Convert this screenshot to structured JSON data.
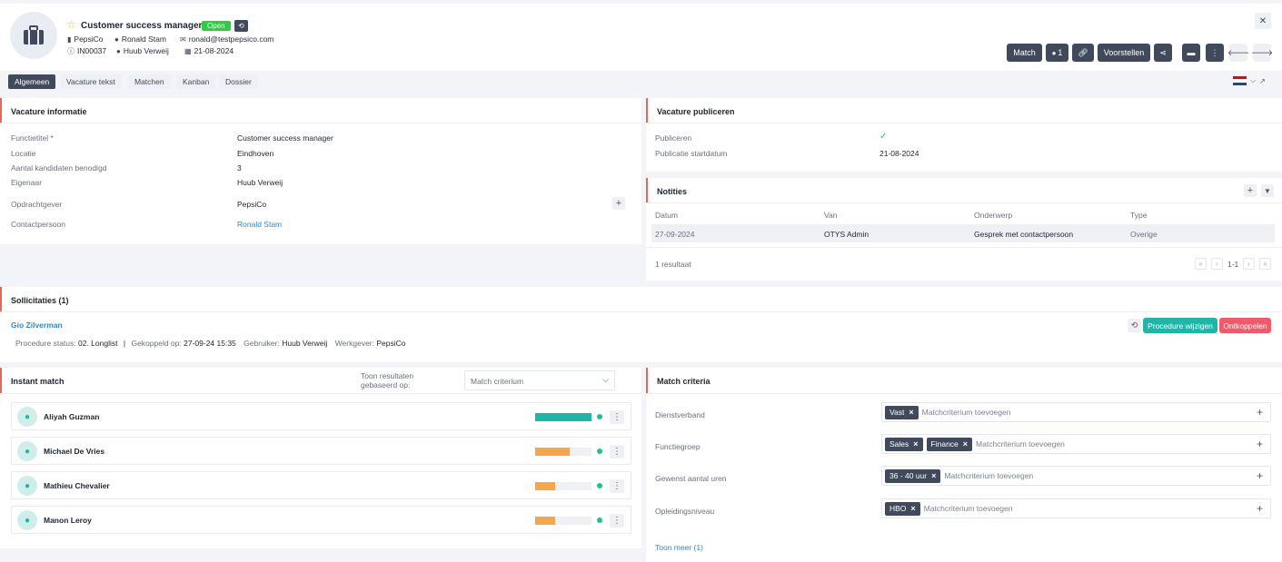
{
  "header": {
    "title": "Customer success manager",
    "status": "Open",
    "company": "PepsiCo",
    "contact": "Ronald Stam",
    "email": "ronald@testpepsico.com",
    "id": "IN00037",
    "owner": "Huub Verweij",
    "date": "21-08-2024",
    "buttons": {
      "match": "Match",
      "count": "1",
      "propose": "Voorstellen"
    }
  },
  "tabs": [
    "Algemeen",
    "Vacature tekst",
    "Matchen",
    "Kanban",
    "Dossier"
  ],
  "vacancy_info": {
    "title": "Vacature informatie",
    "rows": [
      {
        "label": "Functietitel *",
        "value": "Customer success manager"
      },
      {
        "label": "Locatie",
        "value": "Eindhoven"
      },
      {
        "label": "Aantal kandidaten benodigd",
        "value": "3"
      },
      {
        "label": "Eigenaar",
        "value": "Huub Verweij"
      },
      {
        "label": "Opdrachtgever",
        "value": "PepsiCo"
      },
      {
        "label": "Contactpersoon",
        "value": "Ronald Stam"
      }
    ]
  },
  "publish": {
    "title": "Vacature publiceren",
    "publish_label": "Publiceren",
    "publish_value": "✓",
    "start_label": "Publicatie startdatum",
    "start_value": "21-08-2024"
  },
  "notes": {
    "title": "Notities",
    "columns": [
      "Datum",
      "Van",
      "Onderwerp",
      "Type"
    ],
    "rows": [
      [
        "27-09-2024",
        "OTYS Admin",
        "Gesprek met contactpersoon",
        "Overige"
      ]
    ],
    "result": "1 resultaat",
    "page": "1-1"
  },
  "applications": {
    "title": "Sollicitaties (1)",
    "name": "Gio Zilverman",
    "status_label": "Procedure status:",
    "status_value": "02. Longlist",
    "linked_label": "Gekoppeld op:",
    "linked_value": "27-09-24 15:35",
    "user_label": "Gebruiker:",
    "user_value": "Huub Verweij",
    "employer_label": "Werkgever:",
    "employer_value": "PepsiCo",
    "change_button": "Procedure wijzigen",
    "unlink_button": "Ontkoppelen"
  },
  "instant_match": {
    "title": "Instant match",
    "based_label_1": "Toon resultaten",
    "based_label_2": "gebaseerd op:",
    "select_value": "Match criterium",
    "candidates": [
      {
        "name": "Aliyah Guzman",
        "score": 1.0,
        "color": "#20b5a6"
      },
      {
        "name": "Michael De Vries",
        "score": 0.62,
        "color": "#f5a54a"
      },
      {
        "name": "Mathieu Chevalier",
        "score": 0.36,
        "color": "#f5a54a"
      },
      {
        "name": "Manon Leroy",
        "score": 0.36,
        "color": "#f5a54a"
      }
    ]
  },
  "match_criteria": {
    "title": "Match criteria",
    "placeholder": "Matchcriterium toevoegen",
    "rows": [
      {
        "label": "Dienstverband",
        "chips": [
          "Vast"
        ]
      },
      {
        "label": "Functiegroep",
        "chips": [
          "Sales",
          "Finance"
        ]
      },
      {
        "label": "Gewenst aantal uren",
        "chips": [
          "36 - 40 uur"
        ]
      },
      {
        "label": "Opleidingsniveau",
        "chips": [
          "HBO"
        ]
      }
    ],
    "more": "Toon meer (1)"
  },
  "colors": {
    "dark": "#404a5c",
    "accent": "#e8655a",
    "green": "#2ecc40",
    "teal": "#20b5a6",
    "red": "#ee5b6c"
  }
}
